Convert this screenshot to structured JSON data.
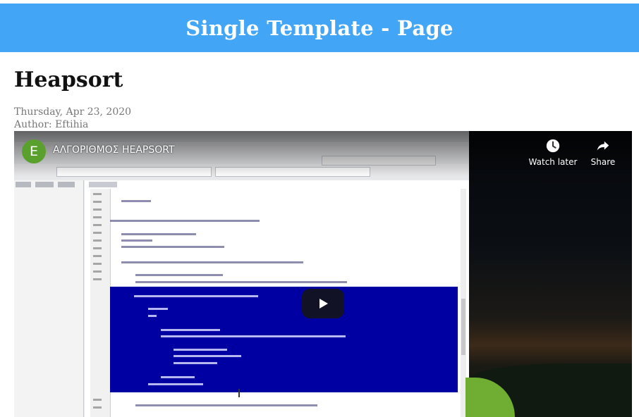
{
  "banner": {
    "title": "Single Template - Page"
  },
  "article": {
    "title": "Heapsort",
    "date": "Thursday, Apr 23, 2020",
    "author_prefix": "Author: ",
    "author": "Eftihia"
  },
  "video": {
    "channel_initial": "E",
    "title": "ΑΛΓΟΡΙΘΜΟΣ HEAPSORT",
    "watch_later_label": "Watch later",
    "share_label": "Share",
    "icons": {
      "avatar": "channel-avatar",
      "watch_later": "clock-icon",
      "share": "share-arrow-icon",
      "play": "play-icon"
    },
    "colors": {
      "avatar": "#5aa02c",
      "play_bg": "#141414",
      "selection": "#0000a2"
    }
  },
  "colors": {
    "banner": "#42a5f5",
    "title": "#111111",
    "meta": "#777777"
  }
}
